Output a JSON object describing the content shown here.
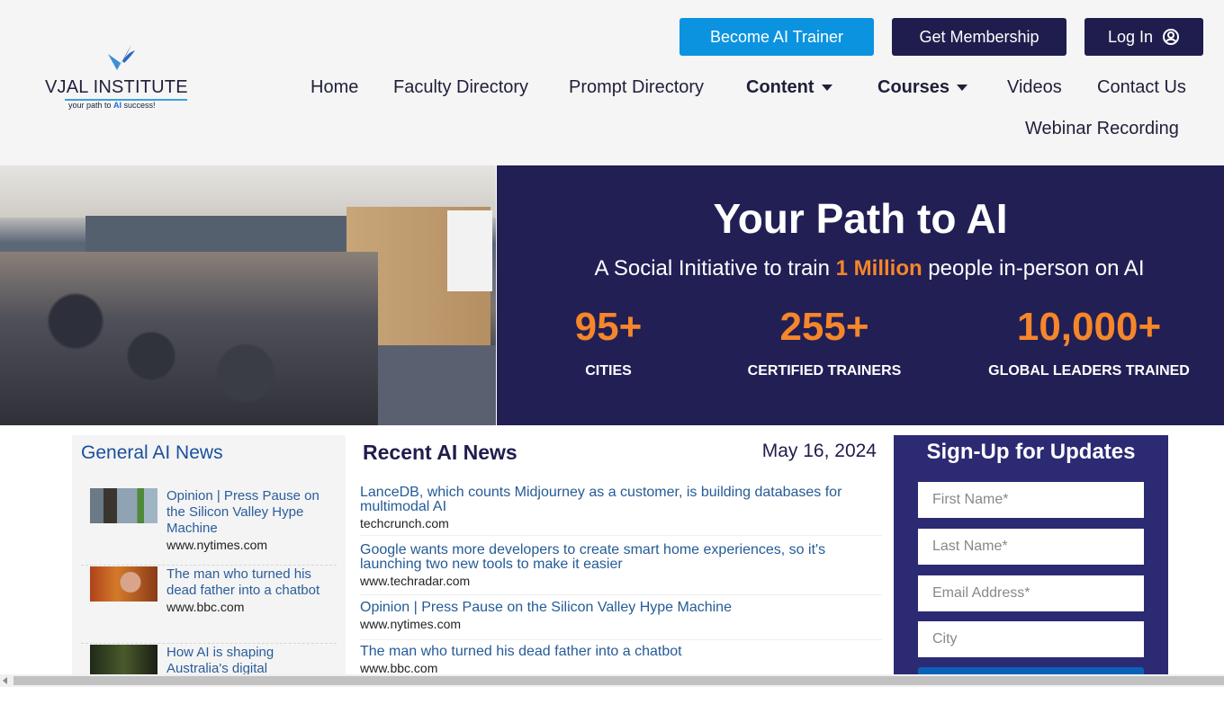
{
  "logo": {
    "name": "VJAL INSTITUTE",
    "tagline_pre": "your path to ",
    "tagline_hl": "AI",
    "tagline_post": " success!"
  },
  "top_buttons": {
    "trainer": "Become AI Trainer",
    "membership": "Get Membership",
    "login": "Log In",
    "login_icon": "user-circle-icon"
  },
  "nav": {
    "items": [
      {
        "label": "Home"
      },
      {
        "label": "Faculty Directory"
      },
      {
        "label": "Prompt Directory"
      },
      {
        "label": "Content",
        "dropdown": true
      },
      {
        "label": "Courses",
        "dropdown": true
      },
      {
        "label": "Videos"
      },
      {
        "label": "Contact Us"
      },
      {
        "label": "Webinar Recording"
      }
    ]
  },
  "hero": {
    "title": "Your Path to AI",
    "subtitle_pre": "A Social Initiative to train ",
    "subtitle_hl": "1 Million",
    "subtitle_post": " people in-person on AI",
    "stats": [
      {
        "value": "95+",
        "label": "CITIES"
      },
      {
        "value": "255+",
        "label": "CERTIFIED TRAINERS"
      },
      {
        "value": "10,000+",
        "label": "GLOBAL LEADERS TRAINED"
      }
    ],
    "colors": {
      "background": "#221f55",
      "accent": "#f5862a"
    }
  },
  "general_news": {
    "heading": "General AI News",
    "items": [
      {
        "title": "Opinion | Press Pause on the Silicon Valley Hype Machine",
        "source": "www.nytimes.com"
      },
      {
        "title": "The man who turned his dead father into a chatbot",
        "source": "www.bbc.com"
      },
      {
        "title": "How AI is shaping Australia's digital",
        "source": ""
      }
    ]
  },
  "recent_news": {
    "heading": "Recent AI News",
    "date": "May 16, 2024",
    "items": [
      {
        "title": "LanceDB, which counts Midjourney as a customer, is building databases for multimodal AI",
        "source": "techcrunch.com"
      },
      {
        "title": "Google wants more developers to create smart home experiences, so it's launching two new tools to make it easier",
        "source": "www.techradar.com"
      },
      {
        "title": "Opinion | Press Pause on the Silicon Valley Hype Machine",
        "source": "www.nytimes.com"
      },
      {
        "title": "The man who turned his dead father into a chatbot",
        "source": "www.bbc.com"
      }
    ]
  },
  "signup": {
    "heading": "Sign-Up for Updates",
    "fields": {
      "first_name": "First Name*",
      "last_name": "Last Name*",
      "email": "Email Address*",
      "city": "City"
    }
  }
}
